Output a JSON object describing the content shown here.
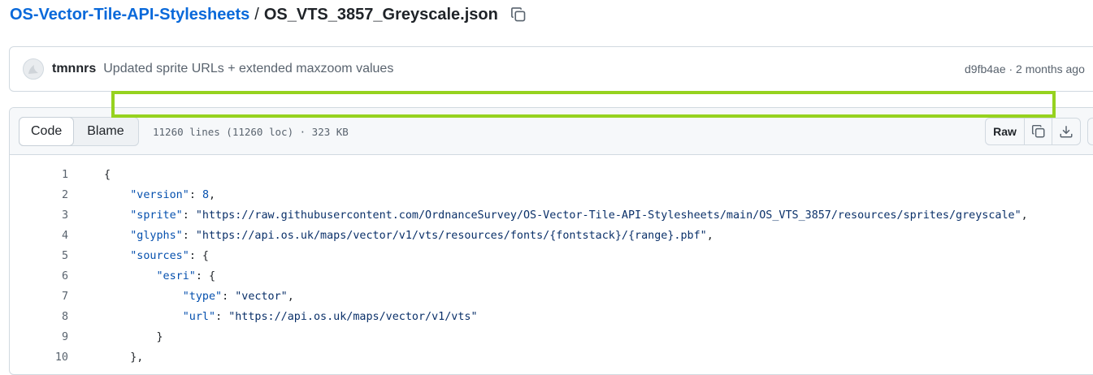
{
  "breadcrumb": {
    "repo": "OS-Vector-Tile-API-Stylesheets",
    "separator": "/",
    "file": "OS_VTS_3857_Greyscale.json",
    "copy_icon": "copy-icon"
  },
  "commit": {
    "author": "tmnnrs",
    "message": "Updated sprite URLs + extended maxzoom values",
    "meta": "d9fb4ae · 2 months ago"
  },
  "file_header": {
    "code_label": "Code",
    "blame_label": "Blame",
    "info": "11260 lines (11260 loc) · 323 KB",
    "raw_label": "Raw"
  },
  "code_lines": [
    {
      "n": "1",
      "parts": [
        [
          "p",
          "{"
        ]
      ]
    },
    {
      "n": "2",
      "parts": [
        [
          "p",
          "    "
        ],
        [
          "k",
          "\"version\""
        ],
        [
          "p",
          ": "
        ],
        [
          "n",
          "8"
        ],
        [
          "p",
          ","
        ]
      ]
    },
    {
      "n": "3",
      "parts": [
        [
          "p",
          "    "
        ],
        [
          "k",
          "\"sprite\""
        ],
        [
          "p",
          ": "
        ],
        [
          "s",
          "\"https://raw.githubusercontent.com/OrdnanceSurvey/OS-Vector-Tile-API-Stylesheets/main/OS_VTS_3857/resources/sprites/greyscale\""
        ],
        [
          "p",
          ","
        ]
      ]
    },
    {
      "n": "4",
      "parts": [
        [
          "p",
          "    "
        ],
        [
          "k",
          "\"glyphs\""
        ],
        [
          "p",
          ": "
        ],
        [
          "s",
          "\"https://api.os.uk/maps/vector/v1/vts/resources/fonts/{fontstack}/{range}.pbf\""
        ],
        [
          "p",
          ","
        ]
      ]
    },
    {
      "n": "5",
      "parts": [
        [
          "p",
          "    "
        ],
        [
          "k",
          "\"sources\""
        ],
        [
          "p",
          ": {"
        ]
      ]
    },
    {
      "n": "6",
      "parts": [
        [
          "p",
          "        "
        ],
        [
          "k",
          "\"esri\""
        ],
        [
          "p",
          ": {"
        ]
      ]
    },
    {
      "n": "7",
      "parts": [
        [
          "p",
          "            "
        ],
        [
          "k",
          "\"type\""
        ],
        [
          "p",
          ": "
        ],
        [
          "s",
          "\"vector\""
        ],
        [
          "p",
          ","
        ]
      ]
    },
    {
      "n": "8",
      "parts": [
        [
          "p",
          "            "
        ],
        [
          "k",
          "\"url\""
        ],
        [
          "p",
          ": "
        ],
        [
          "s",
          "\"https://api.os.uk/maps/vector/v1/vts\""
        ]
      ]
    },
    {
      "n": "9",
      "parts": [
        [
          "p",
          "        }"
        ]
      ]
    },
    {
      "n": "10",
      "parts": [
        [
          "p",
          "    },"
        ]
      ]
    }
  ],
  "colors": {
    "link": "#0969da",
    "highlight": "#96d21f"
  }
}
